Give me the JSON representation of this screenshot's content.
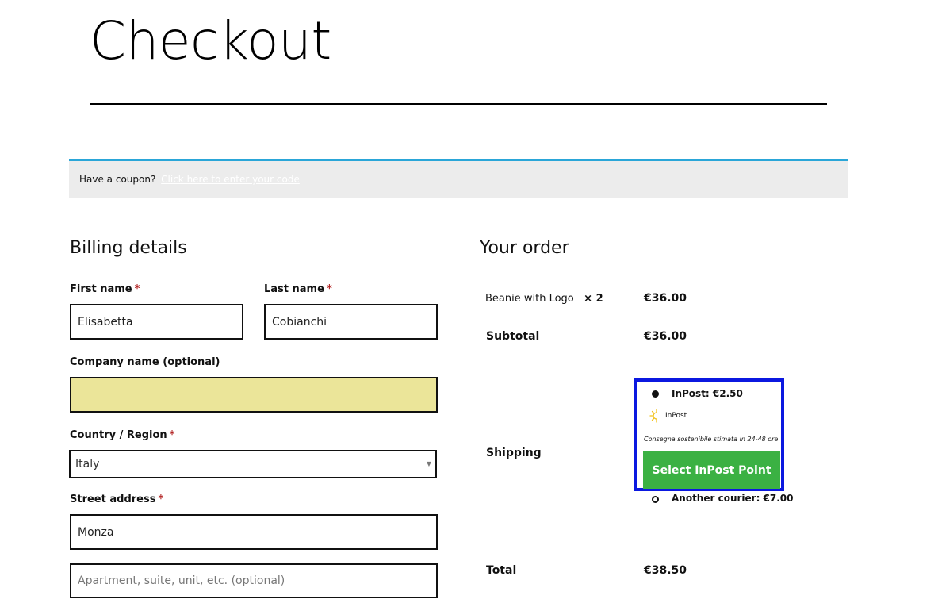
{
  "page": {
    "title": "Checkout"
  },
  "coupon": {
    "prompt": "Have a coupon?",
    "link": "Click here to enter your code"
  },
  "billing": {
    "heading": "Billing details",
    "first_name": {
      "label": "First name",
      "value": "Elisabetta"
    },
    "last_name": {
      "label": "Last name",
      "value": "Cobianchi"
    },
    "company": {
      "label": "Company name (optional)",
      "value": ""
    },
    "country": {
      "label": "Country / Region",
      "value": "Italy"
    },
    "street": {
      "label": "Street address",
      "value": "Monza",
      "placeholder2": "Apartment, suite, unit, etc. (optional)"
    },
    "required_mark": "*"
  },
  "order": {
    "heading": "Your order",
    "item": {
      "name": "Beanie with Logo",
      "qty": "× 2",
      "price": "€36.00"
    },
    "subtotal": {
      "label": "Subtotal",
      "value": "€36.00"
    },
    "shipping": {
      "label": "Shipping",
      "options": [
        {
          "label": "InPost: €2.50",
          "selected": true
        },
        {
          "label": "Another courier: €7.00",
          "selected": false
        }
      ],
      "inpost_brand": "InPost",
      "inpost_note": "Consegna sostenibile stimata in 24-48 ore",
      "inpost_button": "Select InPost Point"
    },
    "total": {
      "label": "Total",
      "value": "€38.50"
    }
  },
  "colors": {
    "accent_border": "#0b18e0",
    "inpost_button": "#3bb143",
    "coupon_topline": "#2aa6d8",
    "autofill_highlight": "#ebe599",
    "required": "#b22222"
  },
  "icons": {
    "select_arrow": "caret-down-icon",
    "inpost_logo": "inpost-sun-icon"
  }
}
